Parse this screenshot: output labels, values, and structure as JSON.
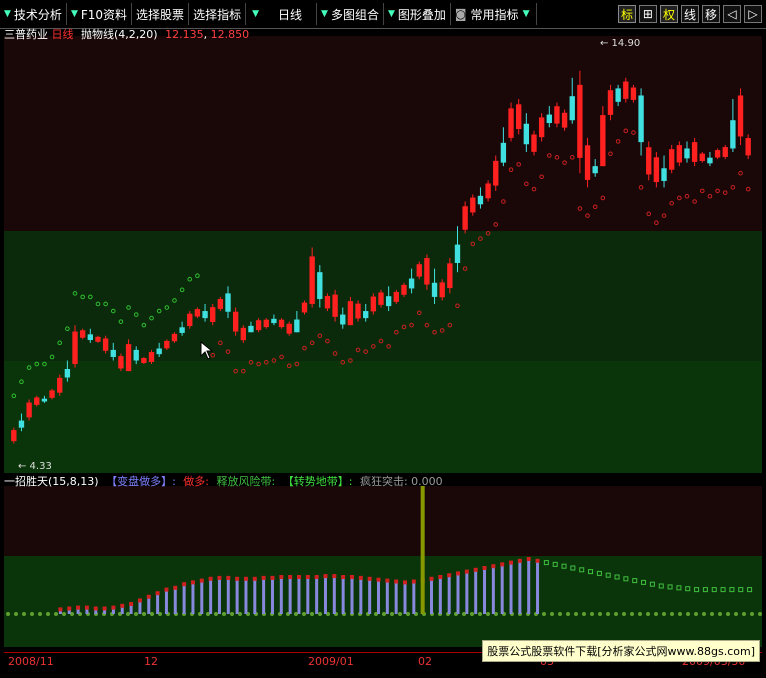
{
  "toolbar": {
    "menus": [
      {
        "label": "技术分析"
      },
      {
        "label": "F10资料"
      },
      {
        "label": "选择股票"
      },
      {
        "label": "选择指标"
      },
      {
        "label": "日线"
      },
      {
        "label": "多图组合"
      },
      {
        "label": "图形叠加"
      },
      {
        "label": "常用指标"
      }
    ],
    "buttons": [
      {
        "label": "标"
      },
      {
        "label": "⊞"
      },
      {
        "label": "权"
      },
      {
        "label": "线"
      },
      {
        "label": "移"
      },
      {
        "label": "◁"
      },
      {
        "label": "▷"
      }
    ]
  },
  "main_panel": {
    "stock_name": "三普药业",
    "period": "日线",
    "indicator": "抛物线(4,2,20)",
    "value1": "12.135",
    "value2": "12.850",
    "high_label": "14.90",
    "low_label": "4.33"
  },
  "indicator_panel": {
    "name": "一招胜天(15,8,13)",
    "label1": "【变盘做多】:",
    "label2": "做多:",
    "label3": "释放风险带:",
    "label4": "【转势地带】:",
    "label5": "疯狂突击:",
    "value5": "0.000"
  },
  "time_axis": {
    "labels": [
      "2008/11",
      "12",
      "2009/01",
      "02",
      "03",
      "2009/03/30"
    ]
  },
  "watermark": "股票公式股票软件下载[分析家公式网www.88gs.com]",
  "colors": {
    "up": "#ff2020",
    "down": "#40e0e0",
    "sar_up": "#cc2020",
    "sar_down": "#30c030",
    "panel_bg_top": "#1a0808",
    "panel_bg_bottom": "#083008",
    "bar_purple": "#8888dd",
    "spike": "#889900"
  },
  "chart_data": [
    {
      "type": "candlestick",
      "title": "三普药业 日线",
      "ylim": [
        3.8,
        15.6
      ],
      "candles": [
        [
          4.6,
          4.8,
          4.35,
          4.33
        ],
        [
          4.8,
          5.2,
          4.7,
          4.75
        ],
        [
          5.1,
          5.6,
          5.0,
          4.95
        ],
        [
          5.5,
          5.7,
          5.4,
          5.3
        ],
        [
          5.6,
          5.7,
          5.5,
          5.45
        ],
        [
          5.7,
          5.9,
          5.6,
          5.5
        ],
        [
          5.8,
          6.3,
          5.7,
          5.6
        ],
        [
          6.3,
          6.7,
          6.1,
          6.0
        ],
        [
          6.6,
          7.7,
          6.5,
          6.4
        ],
        [
          7.5,
          7.6,
          7.3,
          6.9
        ],
        [
          7.4,
          7.6,
          7.2,
          7.1
        ],
        [
          7.3,
          7.4,
          7.2,
          7.1
        ],
        [
          7.3,
          7.4,
          6.9,
          6.9
        ],
        [
          6.9,
          7.2,
          6.7,
          6.6
        ],
        [
          6.8,
          6.9,
          6.4,
          6.3
        ],
        [
          6.4,
          7.3,
          6.4,
          6.2
        ],
        [
          7.0,
          7.1,
          6.6,
          6.5
        ],
        [
          6.7,
          6.8,
          6.6,
          6.5
        ],
        [
          6.7,
          7.0,
          6.6,
          6.6
        ],
        [
          6.9,
          7.2,
          6.8,
          6.7
        ],
        [
          7.1,
          7.3,
          7.0,
          6.9
        ],
        [
          7.3,
          7.5,
          7.2,
          7.1
        ],
        [
          7.5,
          7.8,
          7.4,
          7.3
        ],
        [
          7.8,
          8.1,
          7.6,
          7.5
        ],
        [
          8.0,
          8.2,
          7.9,
          7.7
        ],
        [
          7.9,
          8.3,
          7.8,
          7.7
        ],
        [
          7.8,
          8.3,
          7.7,
          7.5
        ],
        [
          8.2,
          8.5,
          8.1,
          8.0
        ],
        [
          8.6,
          8.8,
          7.9,
          7.8
        ],
        [
          8.0,
          8.2,
          7.4,
          7.3
        ],
        [
          7.4,
          7.7,
          7.2,
          7.1
        ],
        [
          7.5,
          7.8,
          7.5,
          7.3
        ],
        [
          7.8,
          7.9,
          7.5,
          7.4
        ],
        [
          7.7,
          7.9,
          7.6,
          7.5
        ],
        [
          7.8,
          8.0,
          7.7,
          7.6
        ],
        [
          7.7,
          7.9,
          7.6,
          7.5
        ],
        [
          7.6,
          7.8,
          7.4,
          7.3
        ],
        [
          7.5,
          8.1,
          7.5,
          7.4
        ],
        [
          8.1,
          8.4,
          8.0,
          7.9
        ],
        [
          8.3,
          9.9,
          8.2,
          8.1
        ],
        [
          9.2,
          9.4,
          8.2,
          8.1
        ],
        [
          8.2,
          8.6,
          8.1,
          8.0
        ],
        [
          8.4,
          8.7,
          7.8,
          7.7
        ],
        [
          8.0,
          8.2,
          7.6,
          7.5
        ],
        [
          7.7,
          8.5,
          7.7,
          7.6
        ],
        [
          8.3,
          8.4,
          7.8,
          7.7
        ],
        [
          7.9,
          8.3,
          7.8,
          7.7
        ],
        [
          8.1,
          8.6,
          8.0,
          7.9
        ],
        [
          8.5,
          8.7,
          8.2,
          8.1
        ],
        [
          8.3,
          8.8,
          8.1,
          8.0
        ],
        [
          8.5,
          8.7,
          8.3,
          8.2
        ],
        [
          8.6,
          8.9,
          8.5,
          8.4
        ],
        [
          8.8,
          9.3,
          8.6,
          8.5
        ],
        [
          9.2,
          9.5,
          9.0,
          8.9
        ],
        [
          9.6,
          9.7,
          8.7,
          8.6
        ],
        [
          8.9,
          9.3,
          8.3,
          8.2
        ],
        [
          8.5,
          9.0,
          8.4,
          8.3
        ],
        [
          8.9,
          9.6,
          8.6,
          8.5
        ],
        [
          9.5,
          10.5,
          9.2,
          9.1
        ],
        [
          10.4,
          11.2,
          10.3,
          10.2
        ],
        [
          11.0,
          11.4,
          10.8,
          10.7
        ],
        [
          11.2,
          11.6,
          11.0,
          10.9
        ],
        [
          11.4,
          11.8,
          11.2,
          11.1
        ],
        [
          11.7,
          12.5,
          11.5,
          11.4
        ],
        [
          12.3,
          13.3,
          12.2,
          12.1
        ],
        [
          13.0,
          14.0,
          12.9,
          12.8
        ],
        [
          13.8,
          14.1,
          13.1,
          13.0
        ],
        [
          13.4,
          13.7,
          12.6,
          12.5
        ],
        [
          12.8,
          13.2,
          12.5,
          12.4
        ],
        [
          13.1,
          13.7,
          12.9,
          12.8
        ],
        [
          13.5,
          13.9,
          13.3,
          13.2
        ],
        [
          13.7,
          14.0,
          13.3,
          13.2
        ],
        [
          13.5,
          13.8,
          13.2,
          13.1
        ],
        [
          13.5,
          14.7,
          13.4,
          13.3
        ],
        [
          14.5,
          14.9,
          12.0,
          11.9
        ],
        [
          12.6,
          13.0,
          11.6,
          11.5
        ],
        [
          12.0,
          12.4,
          11.9,
          11.8
        ],
        [
          12.2,
          13.9,
          12.2,
          12.1
        ],
        [
          13.8,
          14.5,
          13.5,
          13.4
        ],
        [
          14.4,
          14.5,
          13.9,
          13.8
        ],
        [
          14.3,
          14.7,
          14.0,
          13.9
        ],
        [
          14.1,
          14.5,
          14.0,
          13.9
        ],
        [
          14.2,
          14.4,
          12.5,
          12.4
        ],
        [
          12.7,
          12.9,
          11.8,
          11.7
        ],
        [
          12.1,
          12.6,
          11.6,
          11.5
        ],
        [
          12.0,
          12.5,
          11.6,
          11.5
        ],
        [
          12.1,
          12.8,
          12.0,
          11.9
        ],
        [
          12.7,
          12.9,
          12.2,
          12.1
        ],
        [
          12.7,
          12.9,
          12.3,
          12.2
        ],
        [
          12.6,
          13.0,
          12.2,
          12.1
        ],
        [
          12.5,
          12.6,
          12.3,
          12.2
        ],
        [
          12.3,
          12.6,
          12.2,
          12.1
        ],
        [
          12.5,
          12.7,
          12.4,
          12.3
        ],
        [
          12.6,
          12.8,
          12.4,
          12.3
        ],
        [
          12.7,
          14.1,
          12.6,
          12.5
        ],
        [
          14.2,
          14.4,
          12.8,
          12.7
        ],
        [
          12.9,
          13.1,
          12.4,
          12.3
        ]
      ],
      "sar_up_start": 25,
      "sar_down_start": 0
    },
    {
      "type": "bar",
      "title": "一招胜天(15,8,13)",
      "ylim": [
        0,
        100
      ],
      "values": [
        4,
        5,
        6,
        6,
        5,
        5,
        6,
        8,
        10,
        14,
        18,
        22,
        26,
        28,
        32,
        34,
        36,
        38,
        39,
        39,
        38,
        38,
        38,
        39,
        39,
        40,
        40,
        40,
        40,
        40,
        41,
        41,
        40,
        40,
        39,
        38,
        37,
        36,
        35,
        34,
        35,
        36,
        38,
        40,
        42,
        44,
        46,
        48,
        50,
        52,
        54,
        56,
        58,
        60,
        58,
        56,
        54,
        52,
        50,
        48,
        46,
        44,
        42,
        40,
        38,
        36,
        34,
        32,
        30,
        29,
        28,
        27,
        26,
        26,
        26,
        26,
        26,
        26,
        26
      ],
      "spike_index": 41,
      "spike_value": 100
    }
  ]
}
